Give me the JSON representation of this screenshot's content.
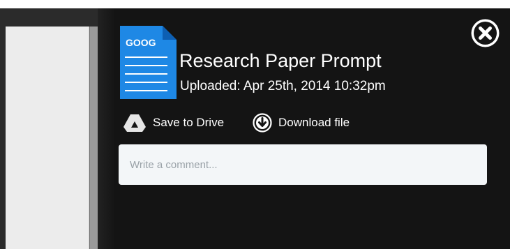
{
  "file": {
    "type_badge": "GOOG",
    "title": "Research Paper Prompt",
    "uploaded": "Uploaded: Apr 25th, 2014 10:32pm"
  },
  "actions": {
    "save_to_drive": "Save to Drive",
    "download_file": "Download file"
  },
  "comment": {
    "placeholder": "Write a comment...",
    "value": ""
  },
  "icons": {
    "close": "close-circle-icon",
    "file": "google-doc-icon",
    "drive": "google-drive-icon",
    "download": "download-circle-icon"
  },
  "colors": {
    "panel_background": "#141414",
    "file_icon_blue": "#1e88e5",
    "comment_box": "#f3f6f8",
    "text": "#ffffff"
  }
}
